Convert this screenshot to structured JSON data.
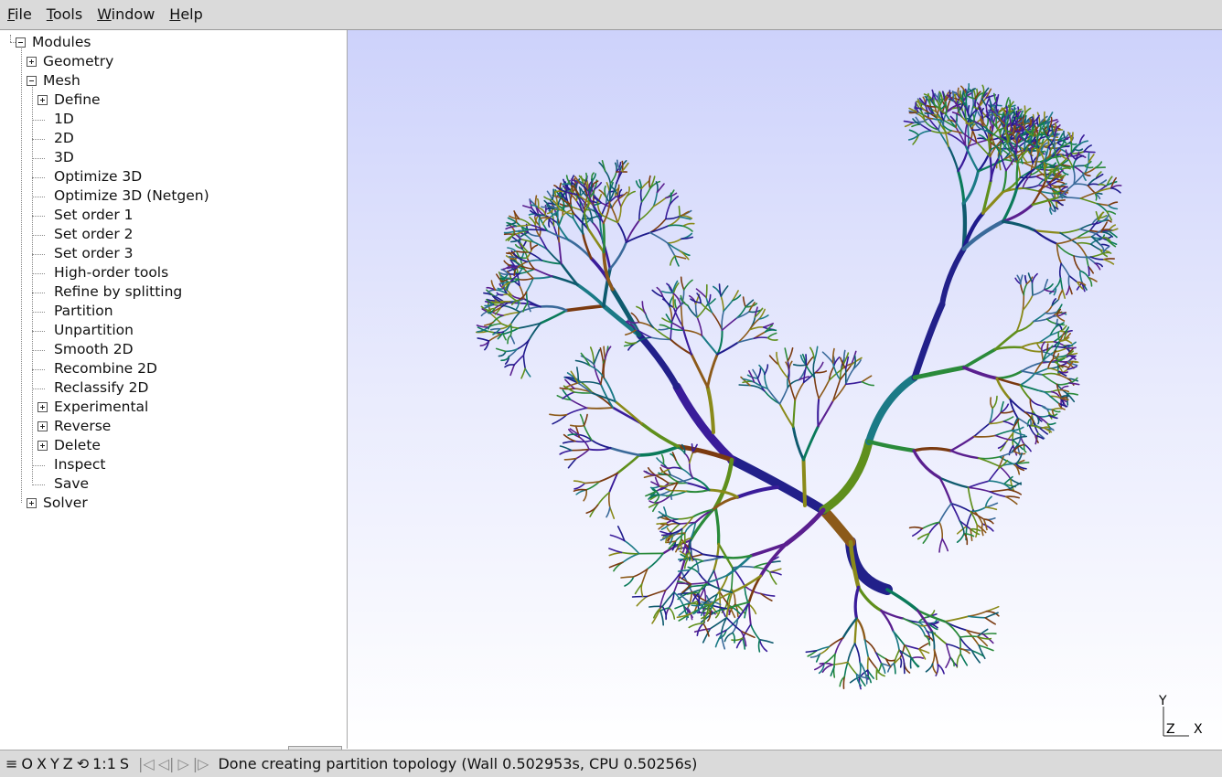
{
  "menubar": {
    "items": [
      {
        "mnemonic": "F",
        "rest": "ile"
      },
      {
        "mnemonic": "T",
        "rest": "ools"
      },
      {
        "mnemonic": "W",
        "rest": "indow"
      },
      {
        "mnemonic": "H",
        "rest": "elp"
      }
    ]
  },
  "tree": {
    "modules": "Modules",
    "geometry": "Geometry",
    "mesh": "Mesh",
    "mesh_items": [
      "Define",
      "1D",
      "2D",
      "3D",
      "Optimize 3D",
      "Optimize 3D (Netgen)",
      "Set order 1",
      "Set order 2",
      "Set order 3",
      "High-order tools",
      "Refine by splitting",
      "Partition",
      "Unpartition",
      "Smooth 2D",
      "Recombine 2D",
      "Reclassify 2D",
      "Experimental",
      "Reverse",
      "Delete",
      "Inspect",
      "Save"
    ],
    "solver": "Solver"
  },
  "axes": {
    "y": "Y",
    "z": "Z",
    "x": "X"
  },
  "statusbar": {
    "menu_glyph": "≡",
    "o": "O",
    "x": "X",
    "y": "Y",
    "z": "Z",
    "rotate_glyph": "⟲",
    "scale": "1:1",
    "s": "S",
    "message": "Done creating partition topology (Wall 0.502953s, CPU 0.50256s)"
  },
  "colors": {
    "branch_palette": [
      "#1f1b8c",
      "#3a1c9a",
      "#5a1f8f",
      "#0e5a6e",
      "#1b7a86",
      "#2a8a3a",
      "#5f8f1c",
      "#8a8a1a",
      "#8c5a1a",
      "#7a3a10",
      "#0a7a5a",
      "#3a6a9a"
    ],
    "trunk": "#22208a"
  }
}
